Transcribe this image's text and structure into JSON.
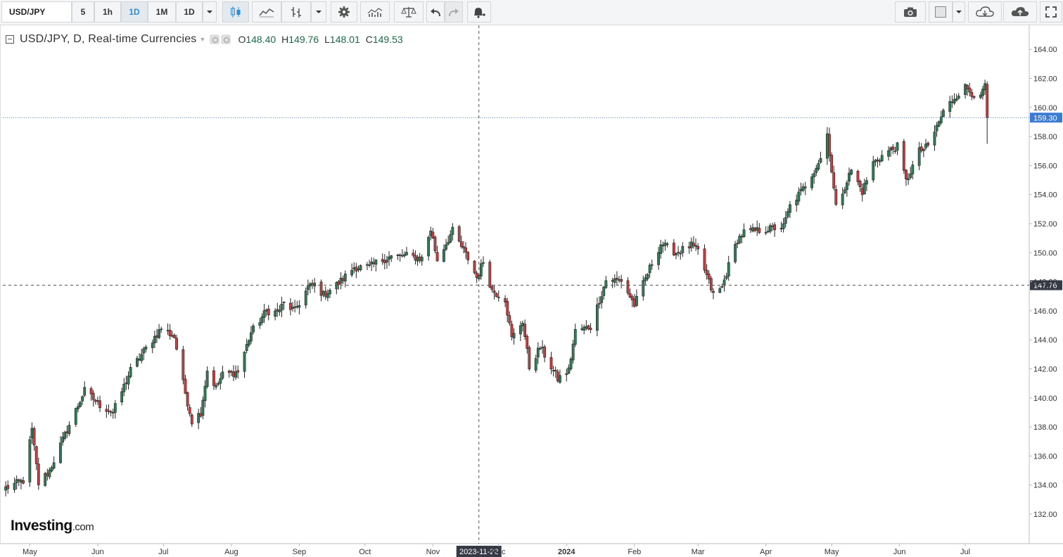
{
  "toolbar": {
    "symbol": "USD/JPY",
    "intervals": [
      {
        "label": "5",
        "active": false
      },
      {
        "label": "1h",
        "active": false
      },
      {
        "label": "1D",
        "active": true
      },
      {
        "label": "1M",
        "active": false
      },
      {
        "label": "1D",
        "active": false
      }
    ],
    "icons": [
      "chevron-down-icon",
      "candles-icon",
      "line-chart-icon",
      "bars-icon",
      "chevron-down-icon",
      "gear-icon",
      "indicators-icon",
      "compare-icon",
      "undo-icon",
      "redo-icon",
      "alert-icon",
      "camera-icon",
      "color-square-icon",
      "chevron-down-icon",
      "cloud-download-icon",
      "cloud-upload-icon",
      "fullscreen-icon"
    ]
  },
  "legend": {
    "title": "USD/JPY, D, Real-time Currencies",
    "open_label": "O",
    "open": "148.40",
    "high_label": "H",
    "high": "149.76",
    "low_label": "L",
    "low": "148.01",
    "close_label": "C",
    "close": "149.53"
  },
  "watermark": {
    "brand": "Investing",
    "suffix": ".com"
  },
  "chart_data": {
    "type": "candlestick",
    "colors": {
      "up": "#2f7d57",
      "down": "#c83e3e",
      "wick": "#222222",
      "last_price": "#3a7bd5",
      "crosshair_label": "#363a45"
    },
    "y_axis": {
      "min": 131,
      "max": 165,
      "ticks": [
        "132.00",
        "134.00",
        "136.00",
        "138.00",
        "140.00",
        "142.00",
        "144.00",
        "146.00",
        "148.00",
        "150.00",
        "152.00",
        "154.00",
        "156.00",
        "158.00",
        "160.00",
        "162.00",
        "164.00"
      ]
    },
    "x_axis": {
      "labels": [
        "May",
        "Jun",
        "Jul",
        "Aug",
        "Sep",
        "Oct",
        "Nov",
        "Dec",
        "2024",
        "Feb",
        "Mar",
        "Apr",
        "May",
        "Jun",
        "Jul"
      ]
    },
    "last_price": 159.3,
    "last_price_label": "159.30",
    "crosshair": {
      "date_label": "2023-11-22",
      "price": 147.76,
      "price_label": "147.76"
    },
    "waypoints": [
      [
        "2023-04-20",
        133.8
      ],
      [
        "2023-04-28",
        134.3
      ],
      [
        "2023-05-02",
        137.8
      ],
      [
        "2023-05-05",
        134.1
      ],
      [
        "2023-05-10",
        135.0
      ],
      [
        "2023-05-18",
        137.8
      ],
      [
        "2023-05-26",
        140.5
      ],
      [
        "2023-06-02",
        139.5
      ],
      [
        "2023-06-08",
        139.0
      ],
      [
        "2023-06-16",
        141.9
      ],
      [
        "2023-06-22",
        143.2
      ],
      [
        "2023-06-30",
        144.8
      ],
      [
        "2023-07-06",
        144.2
      ],
      [
        "2023-07-10",
        141.0
      ],
      [
        "2023-07-14",
        138.4
      ],
      [
        "2023-07-18",
        139.0
      ],
      [
        "2023-07-21",
        141.9
      ],
      [
        "2023-07-25",
        140.7
      ],
      [
        "2023-07-28",
        141.6
      ],
      [
        "2023-08-04",
        141.8
      ],
      [
        "2023-08-10",
        144.5
      ],
      [
        "2023-08-17",
        146.0
      ],
      [
        "2023-08-22",
        145.9
      ],
      [
        "2023-08-25",
        146.5
      ],
      [
        "2023-08-30",
        146.0
      ],
      [
        "2023-09-05",
        147.6
      ],
      [
        "2023-09-08",
        147.8
      ],
      [
        "2023-09-12",
        147.1
      ],
      [
        "2023-09-19",
        147.9
      ],
      [
        "2023-09-26",
        149.0
      ],
      [
        "2023-10-03",
        149.0
      ],
      [
        "2023-10-06",
        149.3
      ],
      [
        "2023-10-12",
        149.7
      ],
      [
        "2023-10-20",
        149.8
      ],
      [
        "2023-10-27",
        149.6
      ],
      [
        "2023-10-31",
        151.6
      ],
      [
        "2023-11-03",
        149.5
      ],
      [
        "2023-11-10",
        151.5
      ],
      [
        "2023-11-14",
        150.4
      ],
      [
        "2023-11-17",
        149.6
      ],
      [
        "2023-11-21",
        148.3
      ],
      [
        "2023-11-24",
        149.4
      ],
      [
        "2023-11-28",
        147.4
      ],
      [
        "2023-12-04",
        146.8
      ],
      [
        "2023-12-07",
        144.1
      ],
      [
        "2023-12-12",
        145.3
      ],
      [
        "2023-12-15",
        142.1
      ],
      [
        "2023-12-20",
        143.5
      ],
      [
        "2023-12-28",
        141.3
      ],
      [
        "2024-01-02",
        141.9
      ],
      [
        "2024-01-05",
        144.6
      ],
      [
        "2024-01-12",
        144.9
      ],
      [
        "2024-01-19",
        148.1
      ],
      [
        "2024-01-26",
        148.1
      ],
      [
        "2024-02-01",
        146.4
      ],
      [
        "2024-02-09",
        149.3
      ],
      [
        "2024-02-13",
        150.6
      ],
      [
        "2024-02-20",
        150.0
      ],
      [
        "2024-02-27",
        150.5
      ],
      [
        "2024-03-01",
        150.1
      ],
      [
        "2024-03-08",
        147.1
      ],
      [
        "2024-03-12",
        147.6
      ],
      [
        "2024-03-15",
        149.1
      ],
      [
        "2024-03-19",
        150.9
      ],
      [
        "2024-03-22",
        151.4
      ],
      [
        "2024-04-01",
        151.6
      ],
      [
        "2024-04-09",
        151.8
      ],
      [
        "2024-04-12",
        153.2
      ],
      [
        "2024-04-19",
        154.6
      ],
      [
        "2024-04-26",
        156.5
      ],
      [
        "2024-04-29",
        158.2
      ],
      [
        "2024-05-03",
        153.1
      ],
      [
        "2024-05-10",
        155.7
      ],
      [
        "2024-05-15",
        154.2
      ],
      [
        "2024-05-20",
        156.2
      ],
      [
        "2024-05-27",
        157.0
      ],
      [
        "2024-05-31",
        157.3
      ],
      [
        "2024-06-04",
        154.9
      ],
      [
        "2024-06-10",
        157.0
      ],
      [
        "2024-06-14",
        157.3
      ],
      [
        "2024-06-21",
        159.7
      ],
      [
        "2024-06-26",
        160.7
      ],
      [
        "2024-07-01",
        161.4
      ],
      [
        "2024-07-05",
        160.9
      ],
      [
        "2024-07-08",
        160.6
      ],
      [
        "2024-07-10",
        161.6
      ],
      [
        "2024-07-11",
        159.3
      ]
    ],
    "last_candle": {
      "date": "2024-07-11",
      "open": 161.6,
      "high": 161.8,
      "low": 157.5,
      "close": 159.3
    }
  }
}
